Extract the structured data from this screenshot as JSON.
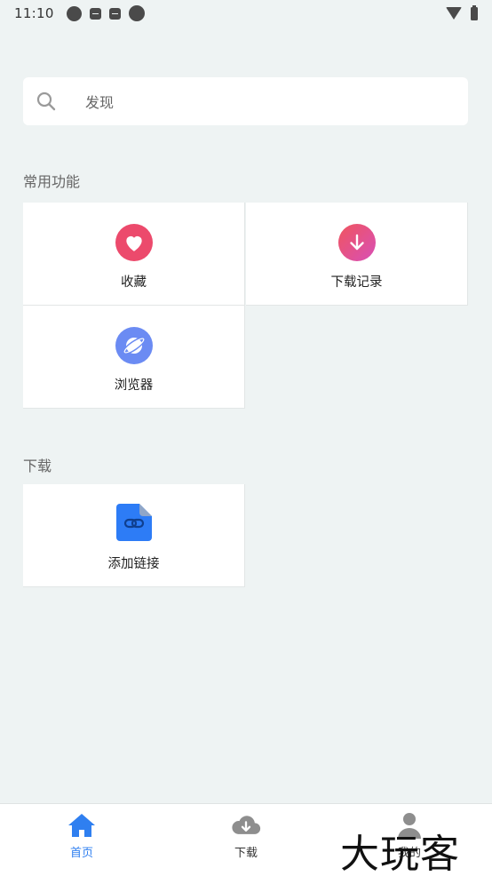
{
  "status_bar": {
    "time": "11:10"
  },
  "search": {
    "placeholder": "发现"
  },
  "sections": {
    "common": {
      "title": "常用功能",
      "items": [
        {
          "label": "收藏",
          "icon": "heart-icon",
          "color": "#ec4a6c"
        },
        {
          "label": "下载记录",
          "icon": "download-arrow-icon",
          "color": "#ee4a8f"
        },
        {
          "label": "浏览器",
          "icon": "planet-icon",
          "color": "#6b8bf3"
        }
      ]
    },
    "download": {
      "title": "下载",
      "items": [
        {
          "label": "添加链接",
          "icon": "link-file-icon",
          "color": "#2d7cf6"
        }
      ]
    }
  },
  "bottom_nav": {
    "items": [
      {
        "label": "首页",
        "icon": "home-icon",
        "active": true
      },
      {
        "label": "下载",
        "icon": "cloud-download-icon",
        "active": false
      },
      {
        "label": "我的",
        "icon": "user-icon",
        "active": false
      }
    ],
    "active_color": "#2f7ff0"
  },
  "watermark": {
    "text": "大玩客"
  }
}
